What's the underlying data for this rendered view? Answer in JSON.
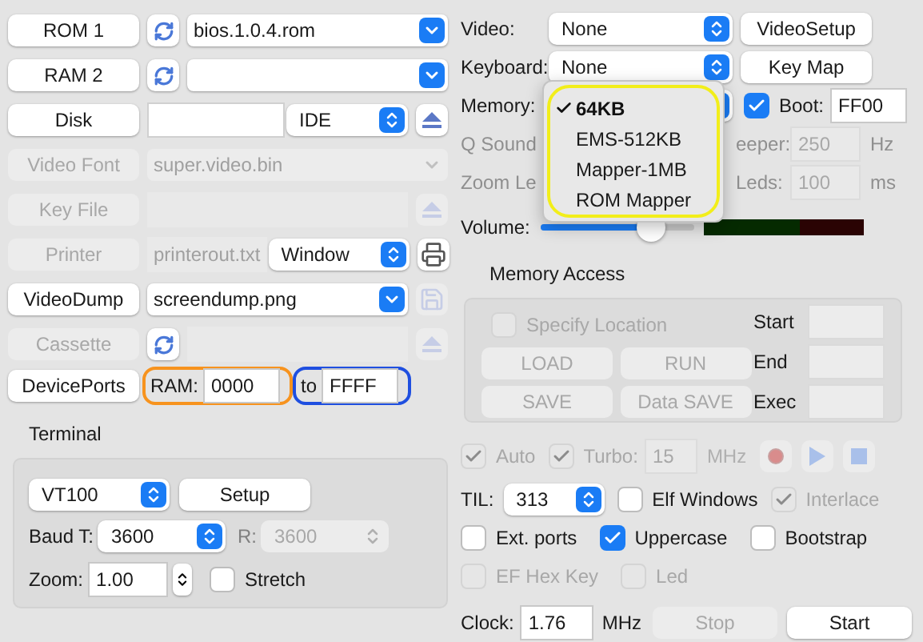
{
  "file_rows": [
    {
      "button": {
        "label": "ROM 1",
        "disabled": false
      },
      "refresh": true,
      "field": {
        "kind": "combo",
        "value": "bios.1.0.4.rom",
        "disabled": false
      }
    },
    {
      "button": {
        "label": "RAM 2",
        "disabled": false
      },
      "refresh": true,
      "field": {
        "kind": "combo",
        "disabled": false
      }
    },
    {
      "button": {
        "label": "Disk",
        "disabled": false
      },
      "refresh": false,
      "field": {
        "kind": "text",
        "disabled": false
      },
      "select": {
        "value": "IDE"
      },
      "tool": {
        "kind": "eject",
        "disabled": false
      }
    },
    {
      "button": {
        "label": "Video Font",
        "disabled": true
      },
      "refresh": false,
      "field": {
        "kind": "combo",
        "value": "super.video.bin",
        "disabled": true
      }
    },
    {
      "button": {
        "label": "Key File",
        "disabled": true
      },
      "refresh": false,
      "field": {
        "kind": "text",
        "disabled": true
      },
      "tool": {
        "kind": "eject",
        "disabled": true
      }
    },
    {
      "button": {
        "label": "Printer",
        "disabled": true
      },
      "refresh": false,
      "field": {
        "kind": "text",
        "value": "printerout.txt",
        "disabled": true
      },
      "select": {
        "value": "Window"
      },
      "tool": {
        "kind": "printer",
        "disabled": false
      }
    },
    {
      "button": {
        "label": "VideoDump",
        "disabled": false
      },
      "refresh": false,
      "field": {
        "kind": "combo",
        "value": "screendump.png",
        "disabled": false
      },
      "tool": {
        "kind": "save",
        "disabled": true
      }
    },
    {
      "button": {
        "label": "Cassette",
        "disabled": true
      },
      "refresh": true,
      "field": {
        "kind": "text",
        "disabled": true
      },
      "tool": {
        "kind": "eject",
        "disabled": true
      }
    }
  ],
  "device_ports": {
    "button": "DevicePorts",
    "ranges": [
      {
        "label": "RAM:",
        "value": "0000",
        "color": "#f7931e"
      },
      {
        "label": "to",
        "value": "FFFF",
        "color": "#1f4fe0"
      }
    ]
  },
  "terminal": {
    "title": "Terminal",
    "type": "VT100",
    "setup": "Setup",
    "baud_t_label": "Baud T:",
    "baud_t": "3600",
    "baud_r_label": "R:",
    "baud_r": "3600",
    "zoom_label": "Zoom:",
    "zoom": "1.00",
    "stretch": {
      "label": "Stretch",
      "checked": false,
      "disabled": false
    }
  },
  "video": {
    "label": "Video:",
    "value": "None",
    "button": "VideoSetup"
  },
  "keyboard": {
    "label": "Keyboard:",
    "value": "None",
    "button": "Key Map"
  },
  "memory": {
    "label": "Memory:",
    "boot": {
      "checked": true,
      "disabled": false
    },
    "boot_label": "Boot:",
    "boot_value": "FF00",
    "menu": [
      {
        "label": "64KB",
        "selected": true
      },
      {
        "label": "EMS-512KB",
        "selected": false
      },
      {
        "label": "Mapper-1MB",
        "selected": false
      },
      {
        "label": "ROM Mapper",
        "selected": false
      }
    ]
  },
  "q_sound": {
    "label": "Q Sound",
    "beeper_label": "eeper:",
    "beeper": "250",
    "unit": "Hz"
  },
  "zoom_leds": {
    "label": "Zoom Le",
    "leds_label": "Leds:",
    "leds": "100",
    "unit": "ms"
  },
  "volume": {
    "label": "Volume:",
    "level": 0.72
  },
  "memory_access": {
    "title": "Memory Access",
    "specify": {
      "label": "Specify Location",
      "checked": false,
      "disabled": true
    },
    "buttons": [
      "LOAD",
      "RUN",
      "SAVE",
      "Data SAVE"
    ],
    "fields": [
      "Start",
      "End",
      "Exec"
    ]
  },
  "speed": {
    "auto": {
      "label": "Auto",
      "checked": true,
      "disabled": true
    },
    "turbo": {
      "label": "Turbo:",
      "checked": true,
      "disabled": true
    },
    "turbo_value": "15",
    "unit": "MHz"
  },
  "til": {
    "label": "TIL:",
    "value": "313",
    "checks": [
      {
        "label": "Elf Windows",
        "checked": false,
        "disabled": false
      },
      {
        "label": "Interlace",
        "checked": true,
        "disabled": true
      }
    ]
  },
  "options": [
    {
      "label": "Ext. ports",
      "checked": false,
      "disabled": false
    },
    {
      "label": "Uppercase",
      "checked": true,
      "disabled": false
    },
    {
      "label": "Bootstrap",
      "checked": false,
      "disabled": false
    }
  ],
  "options2": [
    {
      "label": "EF Hex Key",
      "checked": false,
      "disabled": true
    },
    {
      "label": "Led",
      "checked": false,
      "disabled": true
    }
  ],
  "clock": {
    "label": "Clock:",
    "value": "1.76",
    "unit": "MHz",
    "stop": {
      "label": "Stop",
      "disabled": true
    },
    "start": {
      "label": "Start",
      "disabled": false
    }
  }
}
